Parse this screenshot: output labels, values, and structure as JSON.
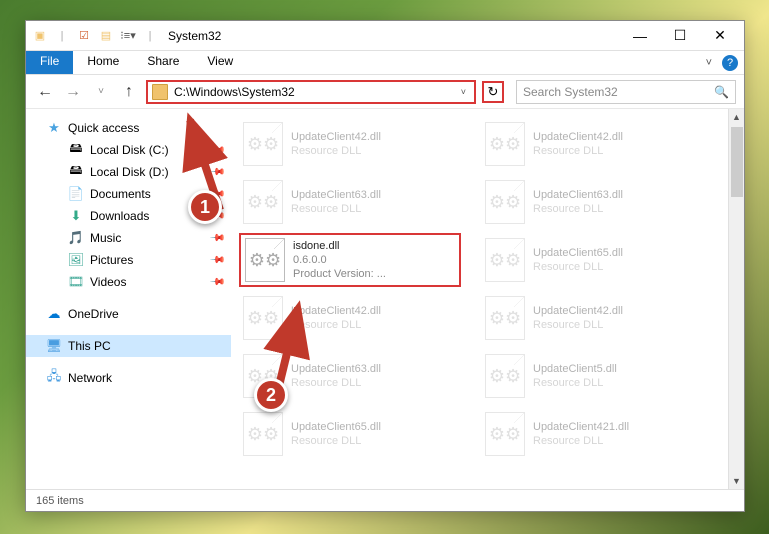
{
  "window": {
    "title": "System32"
  },
  "titlebar_controls": {
    "min": "—",
    "max": "☐",
    "close": "✕"
  },
  "ribbon": {
    "file": "File",
    "tabs": [
      "Home",
      "Share",
      "View"
    ],
    "expand": "˅",
    "help": "?"
  },
  "nav": {
    "back": "←",
    "fwd": "→",
    "recent": "˅",
    "up": "↑"
  },
  "address": {
    "path": "C:\\Windows\\System32",
    "dropdown": "˅",
    "refresh": "↻"
  },
  "search": {
    "placeholder": "Search System32",
    "icon": "🔍"
  },
  "sidebar": {
    "quick": {
      "label": "Quick access",
      "icon": "★",
      "icon_color": "#4aa3e0"
    },
    "items": [
      {
        "label": "Local Disk (C:)",
        "icon": "🖴",
        "pinned": true
      },
      {
        "label": "Local Disk (D:)",
        "icon": "🖴",
        "pinned": true
      },
      {
        "label": "Documents",
        "icon": "📄",
        "pinned": true
      },
      {
        "label": "Downloads",
        "icon": "⬇",
        "pinned": true
      },
      {
        "label": "Music",
        "icon": "🎵",
        "pinned": true
      },
      {
        "label": "Pictures",
        "icon": "🖼",
        "pinned": true
      },
      {
        "label": "Videos",
        "icon": "🎞",
        "pinned": true
      }
    ],
    "onedrive": {
      "label": "OneDrive",
      "icon": "☁",
      "icon_color": "#0078d4"
    },
    "thispc": {
      "label": "This PC",
      "icon": "🖥",
      "selected": true
    },
    "network": {
      "label": "Network",
      "icon": "🖧"
    }
  },
  "files": [
    {
      "name": "UpdateClient42.dll",
      "sub": "Resource DLL",
      "dim": true
    },
    {
      "name": "UpdateClient42.dll",
      "sub": "Resource DLL",
      "dim": true
    },
    {
      "name": "UpdateClient63.dll",
      "sub": "Resource DLL",
      "dim": true
    },
    {
      "name": "UpdateClient63.dll",
      "sub": "Resource DLL",
      "dim": true
    },
    {
      "name": "isdone.dll",
      "sub": "0.6.0.0",
      "sub2": "Product Version:    ...",
      "dim": false,
      "hl": true
    },
    {
      "name": "UpdateClient65.dll",
      "sub": "Resource DLL",
      "dim": true
    },
    {
      "name": "UpdateClient42.dll",
      "sub": "Resource DLL",
      "dim": true
    },
    {
      "name": "UpdateClient42.dll",
      "sub": "Resource DLL",
      "dim": true
    },
    {
      "name": "UpdateClient63.dll",
      "sub": "Resource DLL",
      "dim": true
    },
    {
      "name": "UpdateClient5.dll",
      "sub": "Resource DLL",
      "dim": true
    },
    {
      "name": "UpdateClient65.dll",
      "sub": "Resource DLL",
      "dim": true
    },
    {
      "name": "UpdateClient421.dll",
      "sub": "Resource DLL",
      "dim": true
    }
  ],
  "status": {
    "text": "165 items"
  },
  "callouts": {
    "c1": "1",
    "c2": "2"
  }
}
